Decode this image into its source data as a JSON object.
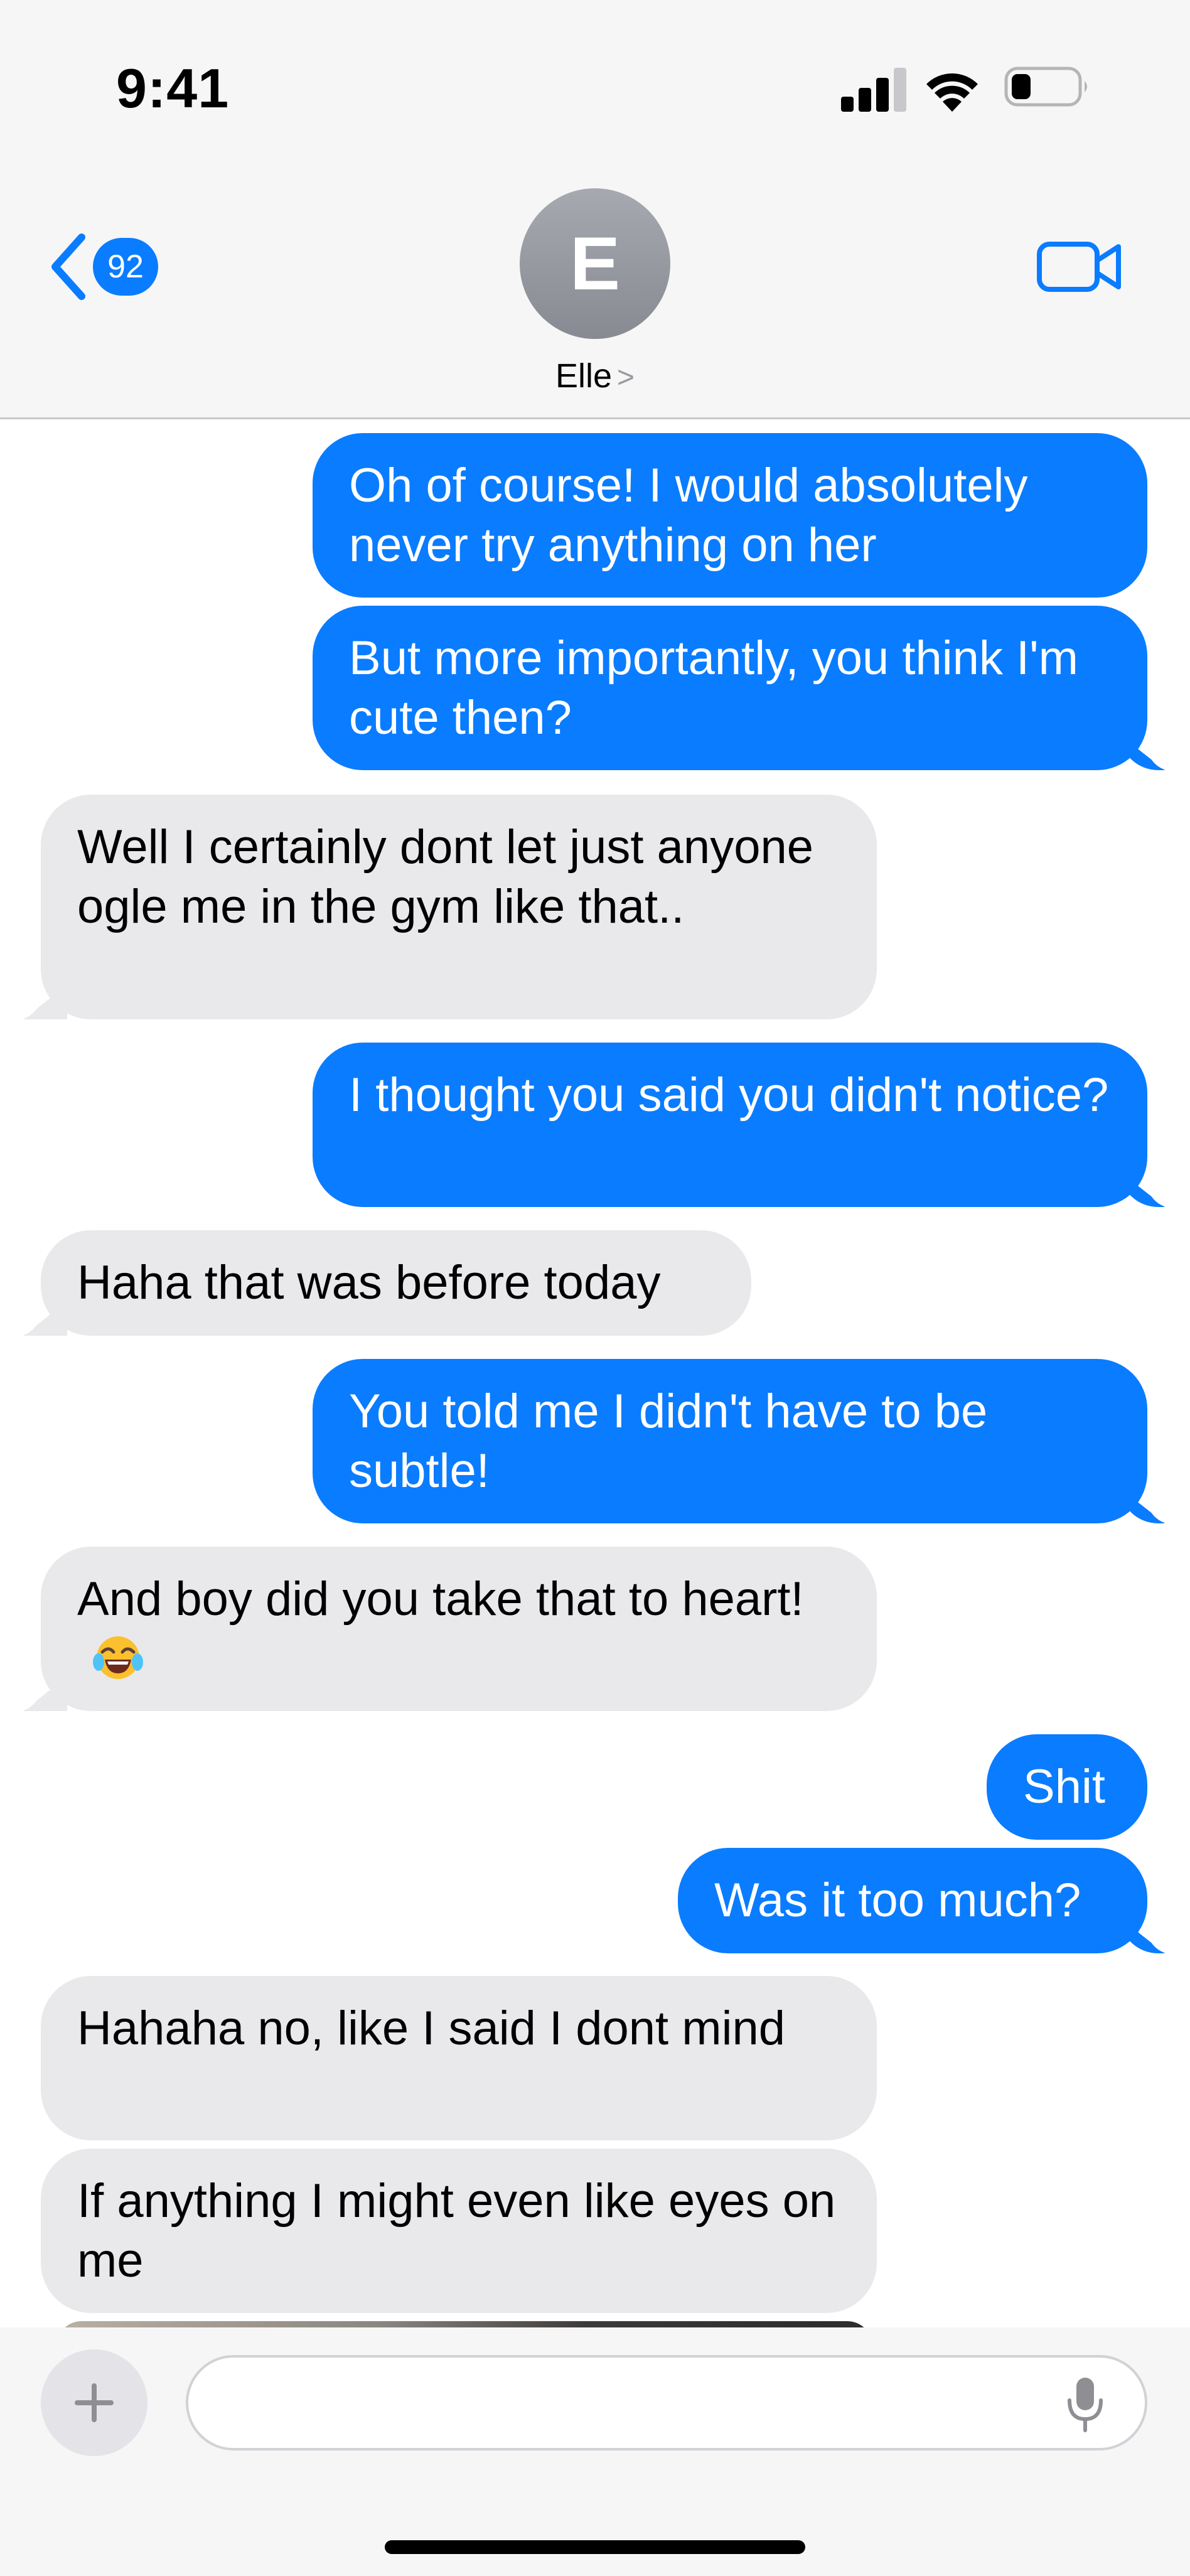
{
  "status_bar": {
    "time": "9:41"
  },
  "nav": {
    "back_badge": "92",
    "avatar_initial": "E",
    "contact_name": "Elle",
    "contact_chevron": ">"
  },
  "messages": [
    {
      "sender": "me",
      "text": "Oh of course! I would absolutely never try anything on her"
    },
    {
      "sender": "me",
      "text": "But more importantly, you think I'm cute then?"
    },
    {
      "sender": "them",
      "text": "Well I certainly dont let just anyone ogle me in the gym like that.."
    },
    {
      "sender": "me",
      "text": "I thought you said you didn't notice?"
    },
    {
      "sender": "them",
      "text": "Haha that was before today"
    },
    {
      "sender": "me",
      "text": "You told me I didn't have to be subtle!"
    },
    {
      "sender": "them",
      "text": "And boy did you take that to heart!",
      "emoji": "face-with-tears-of-joy"
    },
    {
      "sender": "me",
      "text": "Shit"
    },
    {
      "sender": "me",
      "text": "Was it too much?"
    },
    {
      "sender": "them",
      "text": "Hahaha no, like I said I dont mind"
    },
    {
      "sender": "them",
      "text": "If anything I might even like eyes on me"
    }
  ],
  "composer": {
    "value": "",
    "placeholder": ""
  },
  "colors": {
    "outgoing": "#0a7cff",
    "incoming": "#e9e9eb",
    "bar": "#f6f6f6"
  }
}
